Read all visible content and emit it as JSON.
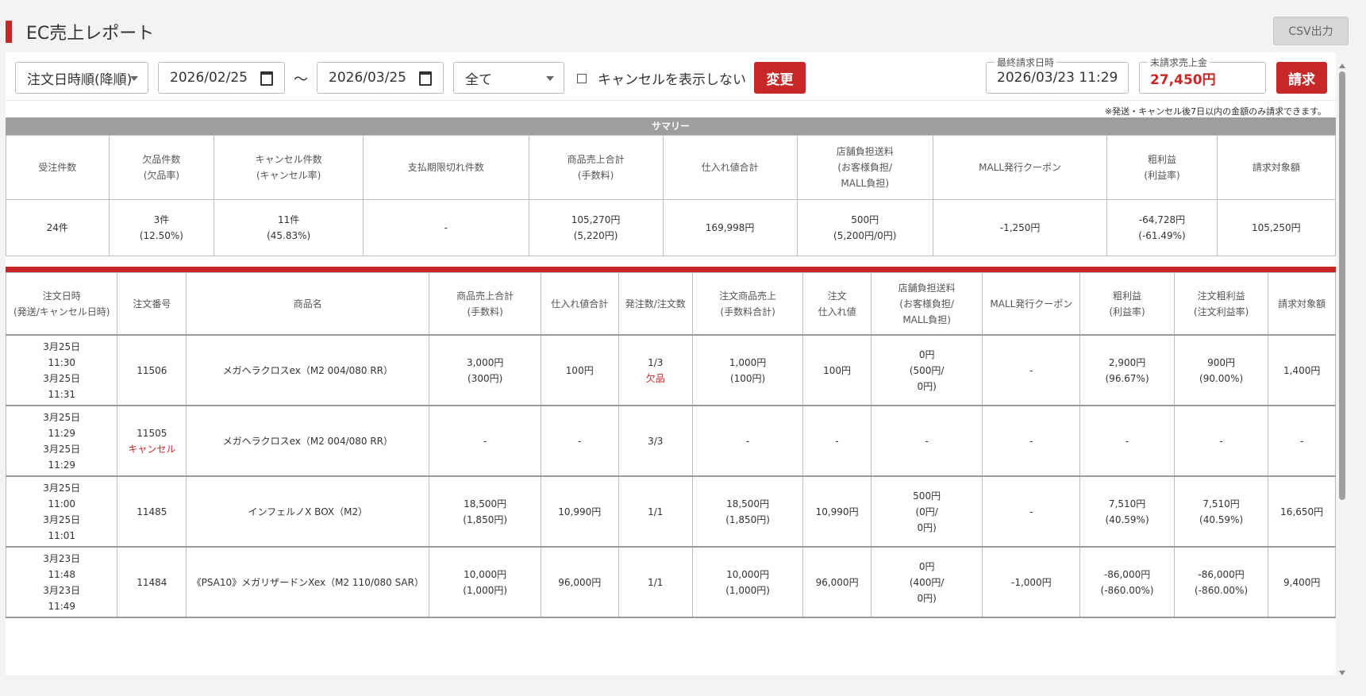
{
  "page": {
    "title": "EC売上レポート",
    "csv_button": "CSV出力"
  },
  "toolbar": {
    "sort_value": "注文日時順(降順)",
    "date_from": "2026/02/25",
    "range_separator": "〜",
    "date_to": "2026/03/25",
    "status_value": "全て",
    "hide_cancel_label": "キャンセルを表示しない",
    "change_button": "変更",
    "last_billing_label": "最終請求日時",
    "last_billing_value": "2026/03/23 11:29",
    "unbilled_label": "未請求売上金",
    "unbilled_value": "27,450円",
    "bill_button": "請求",
    "note": "※発送・キャンセル後7日以内の金額のみ請求できます。"
  },
  "summary": {
    "title": "サマリー",
    "headers": [
      [
        "受注件数"
      ],
      [
        "欠品件数",
        "(欠品率)"
      ],
      [
        "キャンセル件数",
        "(キャンセル率)"
      ],
      [
        "支払期限切れ件数"
      ],
      [
        "商品売上合計",
        "(手数料)"
      ],
      [
        "仕入れ値合計"
      ],
      [
        "店舗負担送料",
        "(お客様負担/",
        "MALL負担)"
      ],
      [
        "MALL発行クーポン"
      ],
      [
        "粗利益",
        "(利益率)"
      ],
      [
        "請求対象額"
      ]
    ],
    "values": [
      [
        "24件"
      ],
      [
        "3件",
        "(12.50%)"
      ],
      [
        "11件",
        "(45.83%)"
      ],
      [
        "-"
      ],
      [
        "105,270円",
        "(5,220円)"
      ],
      [
        "169,998円"
      ],
      [
        "500円",
        "(5,200円/0円)"
      ],
      [
        "-1,250円"
      ],
      [
        "-64,728円",
        "(-61.49%)"
      ],
      [
        "105,250円"
      ]
    ]
  },
  "orders": {
    "headers": [
      [
        "注文日時",
        "(発送/キャンセル日時)"
      ],
      [
        "注文番号"
      ],
      [
        "商品名"
      ],
      [
        "商品売上合計",
        "(手数料)"
      ],
      [
        "仕入れ値合計"
      ],
      [
        "発注数/注文数"
      ],
      [
        "注文商品売上",
        "(手数料合計)"
      ],
      [
        "注文",
        "仕入れ値"
      ],
      [
        "店舗負担送料",
        "(お客様負担/",
        "MALL負担)"
      ],
      [
        "MALL発行クーポン"
      ],
      [
        "粗利益",
        "(利益率)"
      ],
      [
        "注文粗利益",
        "(注文利益率)"
      ],
      [
        "請求対象額"
      ]
    ],
    "rows": [
      {
        "datetime": [
          "3月25日",
          "11:30",
          "3月25日",
          "11:31"
        ],
        "order_no": "11506",
        "order_status": "",
        "product": "メガヘラクロスex（M2 004/080 RR）",
        "sales": [
          "3,000円",
          "(300円)"
        ],
        "cost": "100円",
        "qty": "1/3",
        "qty_status": "欠品",
        "order_sales": [
          "1,000円",
          "(100円)"
        ],
        "order_cost": "100円",
        "shipping": [
          "0円",
          "(500円/",
          "0円)"
        ],
        "coupon": "-",
        "profit": [
          "2,900円",
          "(96.67%)"
        ],
        "order_profit": [
          "900円",
          "(90.00%)"
        ],
        "billable": "1,400円"
      },
      {
        "datetime": [
          "3月25日",
          "11:29",
          "3月25日",
          "11:29"
        ],
        "order_no": "11505",
        "order_status": "キャンセル",
        "product": "メガヘラクロスex（M2 004/080 RR）",
        "sales": [
          "-"
        ],
        "cost": "-",
        "qty": "3/3",
        "qty_status": "",
        "order_sales": [
          "-"
        ],
        "order_cost": "-",
        "shipping": [
          "-"
        ],
        "coupon": "-",
        "profit": [
          "-"
        ],
        "order_profit": [
          "-"
        ],
        "billable": "-"
      },
      {
        "datetime": [
          "3月25日",
          "11:00",
          "3月25日",
          "11:01"
        ],
        "order_no": "11485",
        "order_status": "",
        "product": "インフェルノX BOX（M2）",
        "sales": [
          "18,500円",
          "(1,850円)"
        ],
        "cost": "10,990円",
        "qty": "1/1",
        "qty_status": "",
        "order_sales": [
          "18,500円",
          "(1,850円)"
        ],
        "order_cost": "10,990円",
        "shipping": [
          "500円",
          "(0円/",
          "0円)"
        ],
        "coupon": "-",
        "profit": [
          "7,510円",
          "(40.59%)"
        ],
        "order_profit": [
          "7,510円",
          "(40.59%)"
        ],
        "billable": "16,650円"
      },
      {
        "datetime": [
          "3月23日",
          "11:48",
          "3月23日",
          "11:49"
        ],
        "order_no": "11484",
        "order_status": "",
        "product": "《PSA10》メガリザードンXex（M2 110/080 SAR）",
        "sales": [
          "10,000円",
          "(1,000円)"
        ],
        "cost": "96,000円",
        "qty": "1/1",
        "qty_status": "",
        "order_sales": [
          "10,000円",
          "(1,000円)"
        ],
        "order_cost": "96,000円",
        "shipping": [
          "0円",
          "(400円/",
          "0円)"
        ],
        "coupon": "-1,000円",
        "profit": [
          "-86,000円",
          "(-860.00%)"
        ],
        "order_profit": [
          "-86,000円",
          "(-860.00%)"
        ],
        "billable": "9,400円"
      }
    ]
  },
  "colors": {
    "accent": "#c62828",
    "summary_header": "#9e9e9e",
    "background": "#f3f3f3"
  }
}
